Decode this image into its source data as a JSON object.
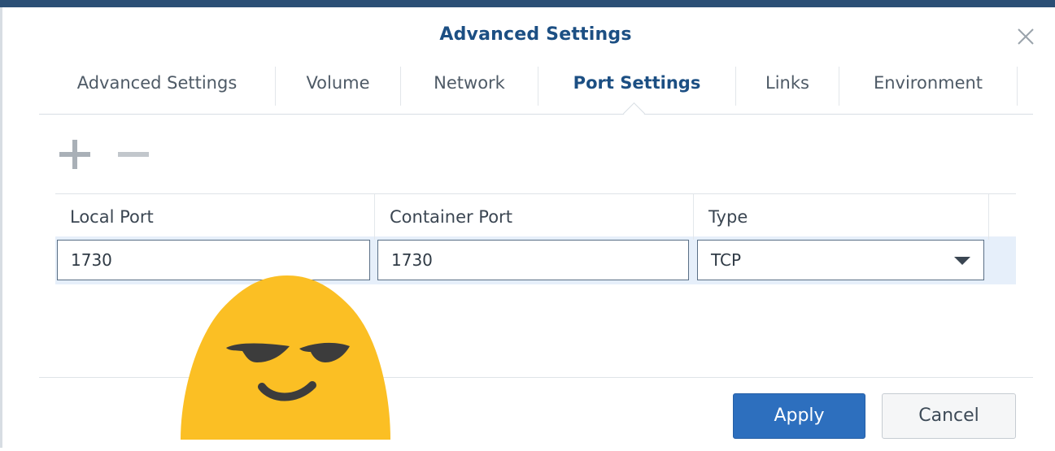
{
  "dialog": {
    "title": "Advanced Settings",
    "close_icon": "close-icon"
  },
  "tabs": [
    {
      "label": "Advanced Settings",
      "active": false
    },
    {
      "label": "Volume",
      "active": false
    },
    {
      "label": "Network",
      "active": false
    },
    {
      "label": "Port Settings",
      "active": true
    },
    {
      "label": "Links",
      "active": false
    },
    {
      "label": "Environment",
      "active": false
    }
  ],
  "toolbar": {
    "add_icon": "plus-icon",
    "remove_icon": "minus-icon"
  },
  "table": {
    "columns": [
      "Local Port",
      "Container Port",
      "Type"
    ],
    "rows": [
      {
        "local_port": "1730",
        "container_port": "1730",
        "type": "TCP"
      }
    ]
  },
  "footer": {
    "apply_label": "Apply",
    "cancel_label": "Cancel"
  },
  "overlay": {
    "emoji_icon": "smirking-face-icon"
  },
  "colors": {
    "title": "#1c4f83",
    "accent": "#2d6fbe",
    "emoji": "#fbbf24"
  }
}
